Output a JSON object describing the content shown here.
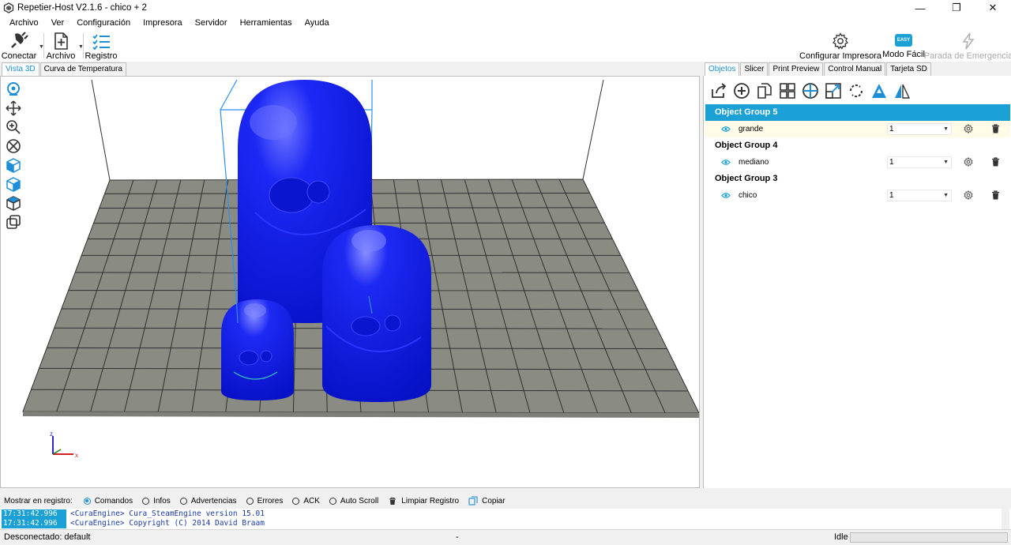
{
  "window": {
    "title": "Repetier-Host V2.1.6 - chico + 2",
    "minimize": "—",
    "restore": "❐",
    "close": "✕"
  },
  "menu": [
    "Archivo",
    "Ver",
    "Configuración",
    "Impresora",
    "Servidor",
    "Herramientas",
    "Ayuda"
  ],
  "toolbar": {
    "connect": "Conectar",
    "file": "Archivo",
    "log": "Registro",
    "printer_settings": "Configurar Impresora",
    "easy_mode": "Modo Fácil",
    "easy_badge": "EASY",
    "emergency_stop": "Parada de Emergencia"
  },
  "view_tabs": [
    "Vista 3D",
    "Curva de Temperatura"
  ],
  "viewport": {
    "axis_x": "x",
    "axis_z": "z",
    "colors": {
      "model": "#0a17f0",
      "bed": "#8a8c84",
      "grid": "#2f3030",
      "box": "#2e8ef0"
    }
  },
  "right_tabs": [
    "Objetos",
    "Slicer",
    "Print Preview",
    "Control Manual",
    "Tarjeta SD"
  ],
  "objects": {
    "groups": [
      {
        "name": "Object Group 5",
        "selected": true,
        "items": [
          {
            "name": "grande",
            "value": "1"
          }
        ]
      },
      {
        "name": "Object Group 4",
        "selected": false,
        "items": [
          {
            "name": "mediano",
            "value": "1"
          }
        ]
      },
      {
        "name": "Object Group 3",
        "selected": false,
        "items": [
          {
            "name": "chico",
            "value": "1"
          }
        ]
      }
    ]
  },
  "log": {
    "label": "Mostrar en registro:",
    "options": [
      {
        "label": "Comandos",
        "checked": true
      },
      {
        "label": "Infos",
        "checked": false
      },
      {
        "label": "Advertencias",
        "checked": false
      },
      {
        "label": "Errores",
        "checked": false
      },
      {
        "label": "ACK",
        "checked": false
      },
      {
        "label": "Auto Scroll",
        "checked": false
      }
    ],
    "clear": "Limpiar Registro",
    "copy": "Copiar",
    "lines": [
      {
        "time": "17:31:42.996",
        "text": "<CuraEngine> Cura_SteamEngine version 15.01"
      },
      {
        "time": "17:31:42.996",
        "text": "<CuraEngine> Copyright (C) 2014 David Braam"
      }
    ]
  },
  "status": {
    "connection": "Desconectado: default",
    "middle": "-",
    "state": "Idle"
  }
}
